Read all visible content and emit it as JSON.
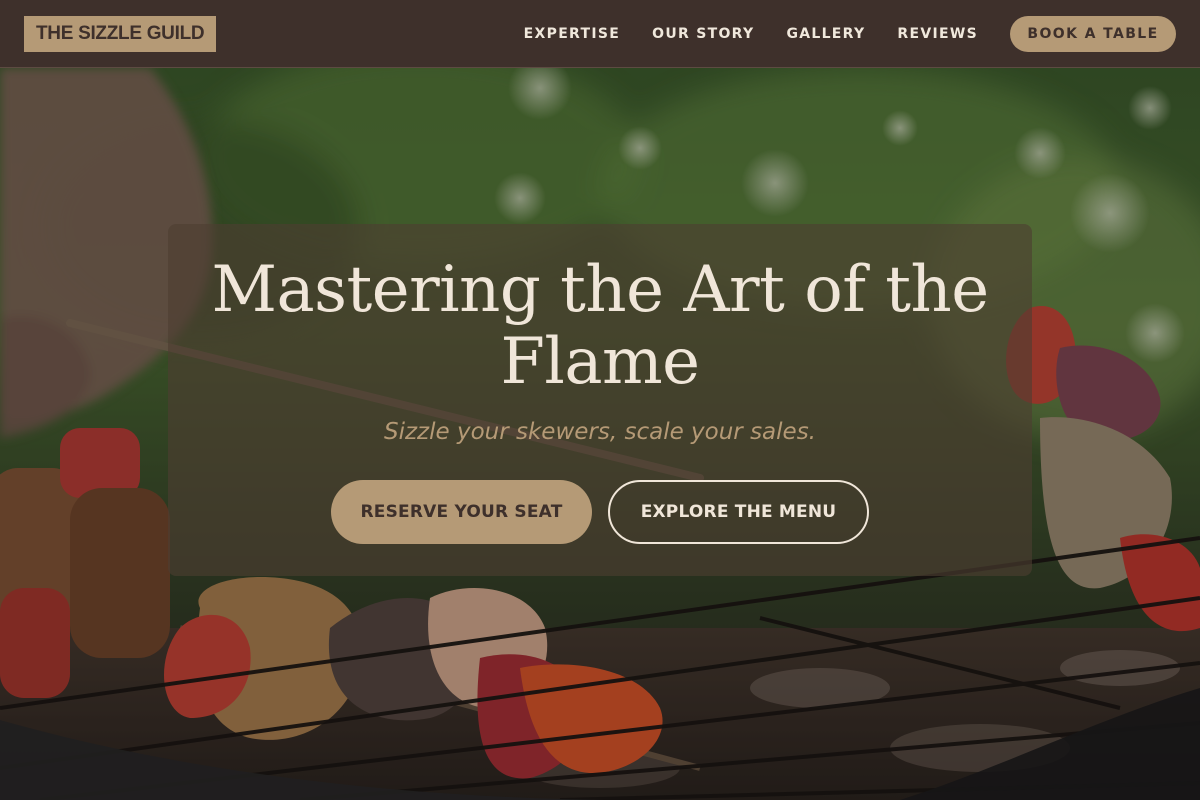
{
  "header": {
    "logo": "THE SIZZLE GUILD",
    "nav": [
      {
        "label": "EXPERTISE"
      },
      {
        "label": "OUR STORY"
      },
      {
        "label": "GALLERY"
      },
      {
        "label": "REVIEWS"
      }
    ],
    "cta_label": "BOOK A TABLE"
  },
  "hero": {
    "title": "Mastering the Art of the Flame",
    "subtitle": "Sizzle your skewers, scale your sales.",
    "primary_button": "RESERVE YOUR SEAT",
    "secondary_button": "EXPLORE THE MENU"
  },
  "colors": {
    "header_bg": "#3e302b",
    "accent": "#b59a76",
    "cream": "#f0e6d9"
  }
}
